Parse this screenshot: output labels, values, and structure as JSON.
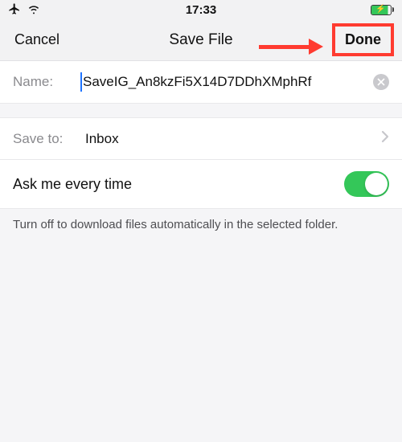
{
  "statusbar": {
    "time": "17:33"
  },
  "navbar": {
    "cancel": "Cancel",
    "title": "Save File",
    "done": "Done"
  },
  "name": {
    "label": "Name:",
    "value": "SaveIG_An8kzFi5X14D7DDhXMphRf"
  },
  "saveto": {
    "label": "Save to:",
    "value": "Inbox"
  },
  "askToggle": {
    "label": "Ask me every time",
    "on": true
  },
  "footer": {
    "note": "Turn off to download files automatically in the selected folder."
  }
}
